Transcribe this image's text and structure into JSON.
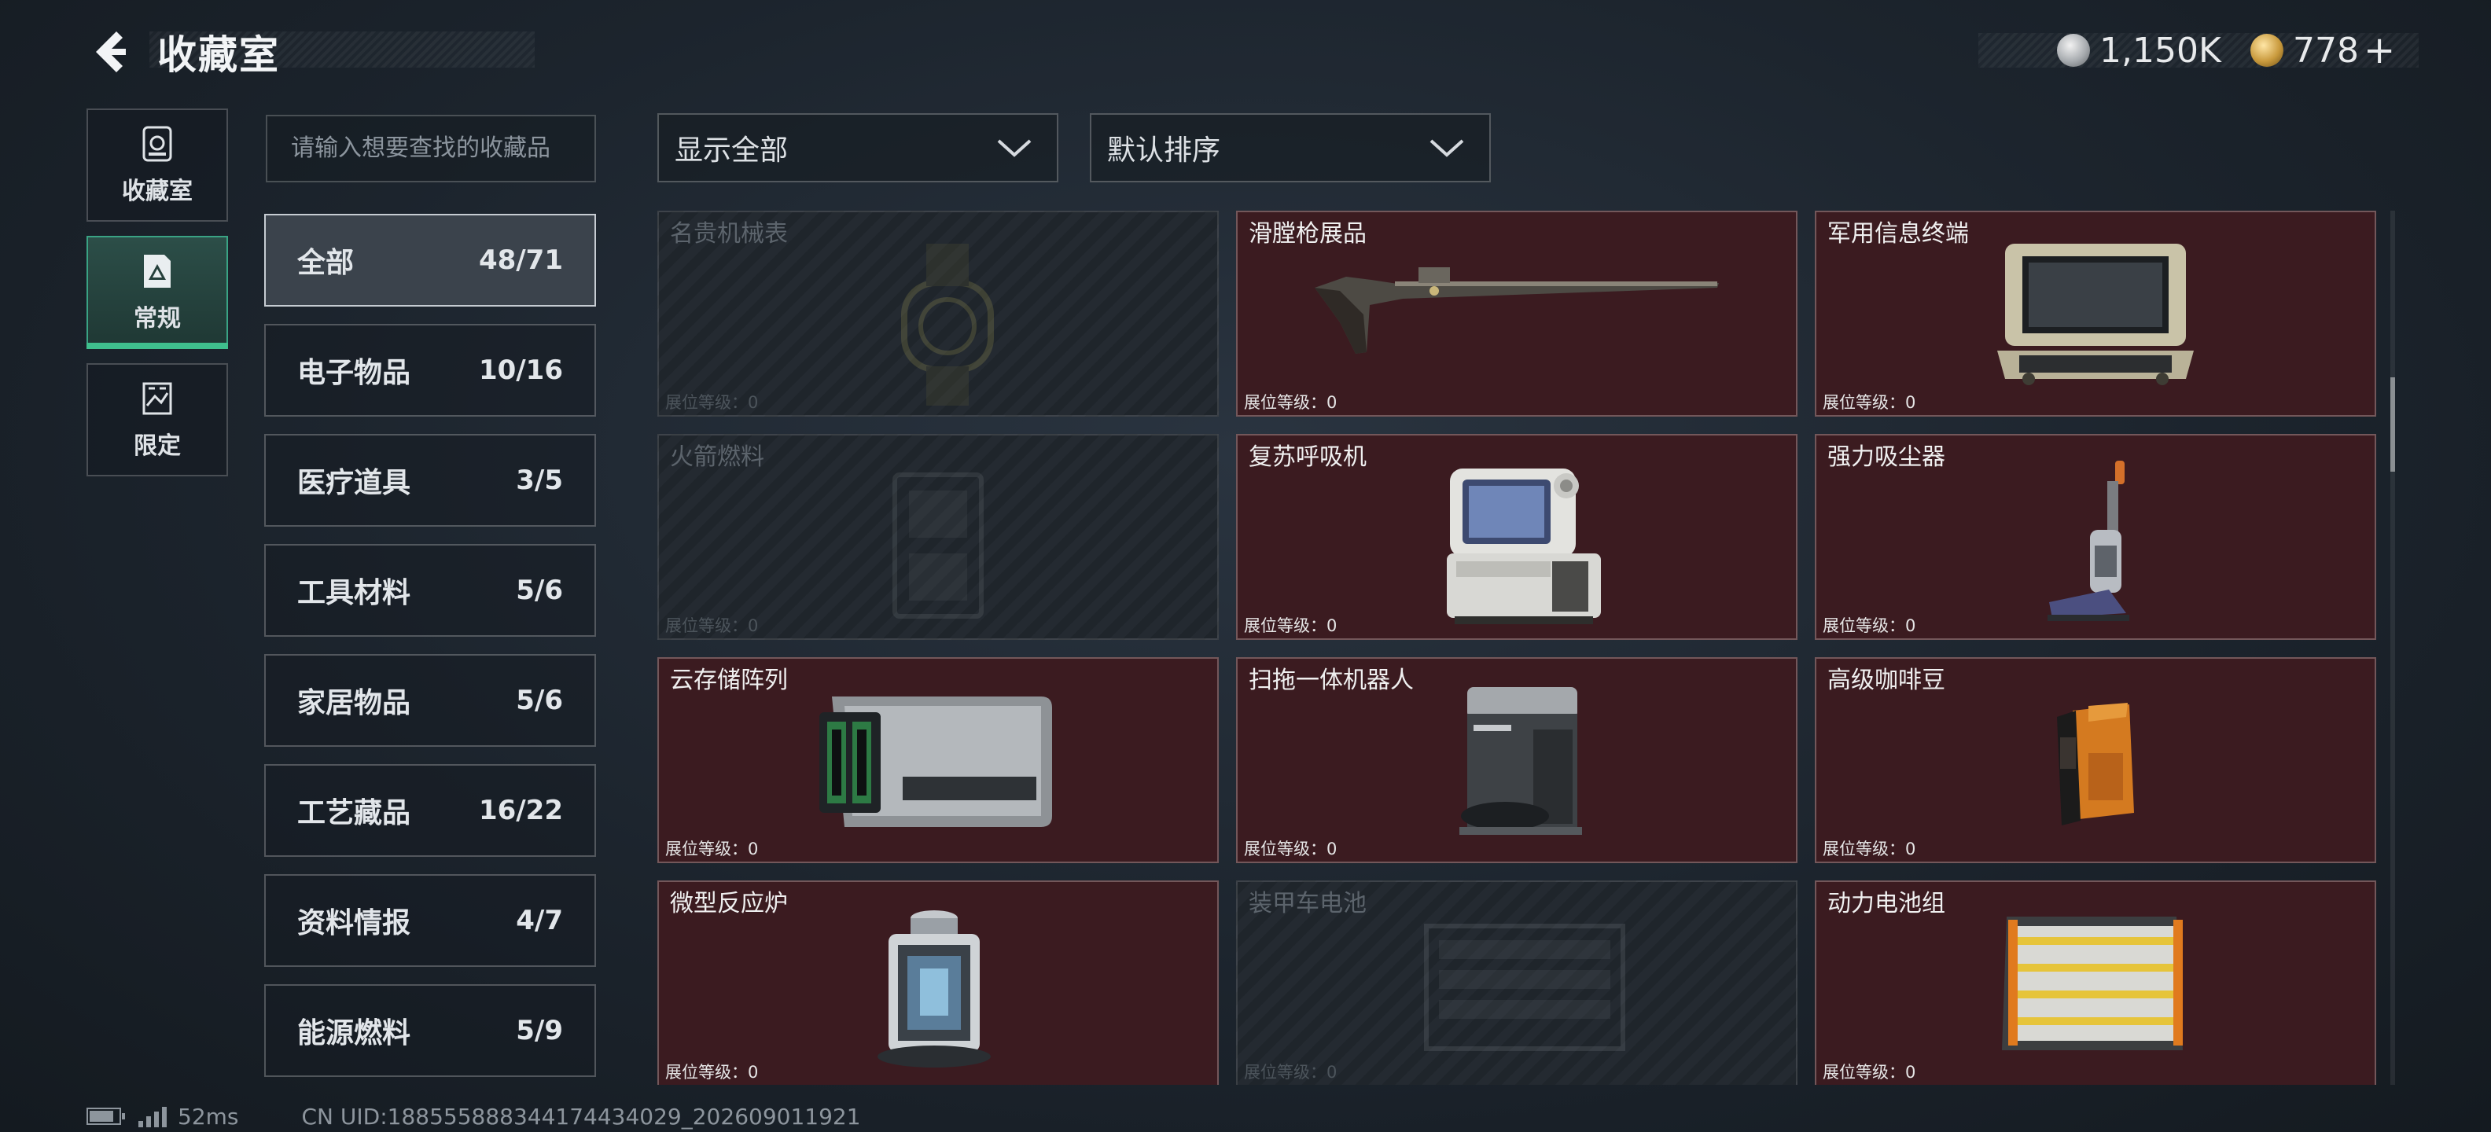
{
  "header": {
    "title": "收藏室",
    "currency_silver": "1,150K",
    "currency_gold": "778",
    "currency_plus": "+"
  },
  "rail": [
    {
      "label": "收藏室",
      "icon": "vault-icon",
      "active": false
    },
    {
      "label": "常规",
      "icon": "regular-collection-icon",
      "active": true
    },
    {
      "label": "限定",
      "icon": "limited-collection-icon",
      "active": false
    }
  ],
  "search": {
    "placeholder": "请输入想要查找的收藏品"
  },
  "filters": {
    "show": "显示全部",
    "sort": "默认排序"
  },
  "categories": [
    {
      "name": "全部",
      "count": "48/71",
      "active": true
    },
    {
      "name": "电子物品",
      "count": "10/16"
    },
    {
      "name": "医疗道具",
      "count": "3/5"
    },
    {
      "name": "工具材料",
      "count": "5/6"
    },
    {
      "name": "家居物品",
      "count": "5/6"
    },
    {
      "name": "工艺藏品",
      "count": "16/22"
    },
    {
      "name": "资料情报",
      "count": "4/7"
    },
    {
      "name": "能源燃料",
      "count": "5/9"
    }
  ],
  "items": [
    {
      "name": "名贵机械表",
      "level": "展位等级：0",
      "owned": false,
      "icon": "watch-icon"
    },
    {
      "name": "滑膛枪展品",
      "level": "展位等级：0",
      "owned": true,
      "icon": "musket-icon"
    },
    {
      "name": "军用信息终端",
      "level": "展位等级：0",
      "owned": true,
      "icon": "military-terminal-icon"
    },
    {
      "name": "火箭燃料",
      "level": "展位等级：0",
      "owned": false,
      "icon": "rocket-fuel-icon"
    },
    {
      "name": "复苏呼吸机",
      "level": "展位等级：0",
      "owned": true,
      "icon": "ventilator-icon"
    },
    {
      "name": "强力吸尘器",
      "level": "展位等级：0",
      "owned": true,
      "icon": "vacuum-cleaner-icon"
    },
    {
      "name": "云存储阵列",
      "level": "展位等级：0",
      "owned": true,
      "icon": "storage-array-icon"
    },
    {
      "name": "扫拖一体机器人",
      "level": "展位等级：0",
      "owned": true,
      "icon": "robot-vacuum-icon"
    },
    {
      "name": "高级咖啡豆",
      "level": "展位等级：0",
      "owned": true,
      "icon": "coffee-beans-icon"
    },
    {
      "name": "微型反应炉",
      "level": "展位等级：0",
      "owned": true,
      "icon": "micro-reactor-icon"
    },
    {
      "name": "装甲车电池",
      "level": "展位等级：0",
      "owned": false,
      "icon": "armored-battery-icon"
    },
    {
      "name": "动力电池组",
      "level": "展位等级：0",
      "owned": true,
      "icon": "power-battery-pack-icon"
    }
  ],
  "footer": {
    "ping": "52ms",
    "uid": "CN UID:188555888344174434029_202609011921"
  }
}
